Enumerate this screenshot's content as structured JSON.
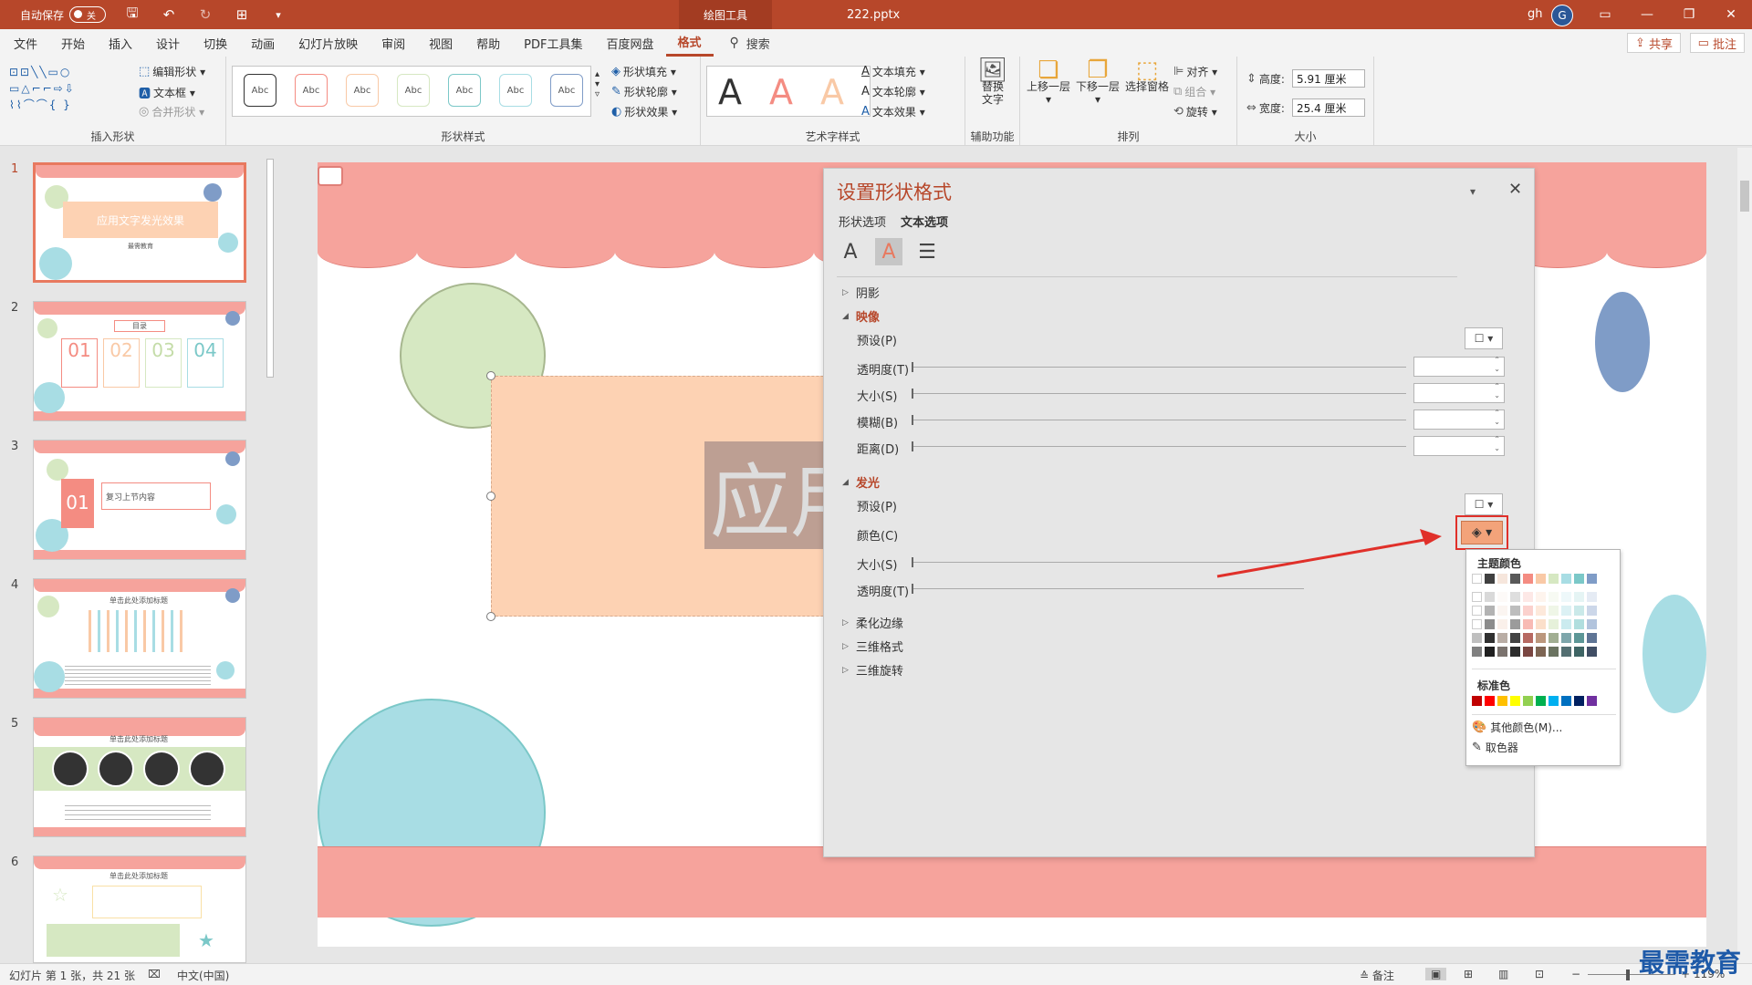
{
  "titlebar": {
    "autosave_label": "自动保存",
    "autosave_state": "关",
    "contextual_tab": "绘图工具",
    "doc_title": "222.pptx",
    "user_name": "gh",
    "user_initial": "G"
  },
  "menu": {
    "tabs": [
      "文件",
      "开始",
      "插入",
      "设计",
      "切换",
      "动画",
      "幻灯片放映",
      "审阅",
      "视图",
      "帮助",
      "PDF工具集",
      "百度网盘",
      "格式"
    ],
    "active_tab": "格式",
    "search_label": "搜索",
    "share_label": "共享",
    "comment_label": "批注"
  },
  "ribbon": {
    "insert_shapes": {
      "label": "插入形状",
      "edit_shape": "编辑形状",
      "text_box": "文本框",
      "merge_shapes": "合并形状"
    },
    "shape_styles": {
      "label": "形状样式",
      "swatch_text": "Abc",
      "fill": "形状填充",
      "outline": "形状轮廓",
      "effects": "形状效果"
    },
    "wordart": {
      "label": "艺术字样式",
      "letter": "A",
      "text_fill": "文本填充",
      "text_outline": "文本轮廓",
      "text_effects": "文本效果"
    },
    "accessibility": {
      "label": "辅助功能",
      "alt_text_line1": "替换",
      "alt_text_line2": "文字"
    },
    "arrange": {
      "label": "排列",
      "bring_forward": "上移一层",
      "send_backward": "下移一层",
      "selection_pane": "选择窗格",
      "align": "对齐",
      "group": "组合",
      "rotate": "旋转"
    },
    "size": {
      "label": "大小",
      "height_label": "高度:",
      "height_value": "5.91 厘米",
      "width_label": "宽度:",
      "width_value": "25.4 厘米"
    }
  },
  "thumbnails": [
    {
      "num": "1",
      "text": "应用文字发光效果",
      "sub": "最需教育"
    },
    {
      "num": "2",
      "text": "目录",
      "items": [
        "01",
        "02",
        "03",
        "04"
      ]
    },
    {
      "num": "3",
      "text": "复习上节内容",
      "badge": "01"
    },
    {
      "num": "4",
      "text": "单击此处添加标题"
    },
    {
      "num": "5",
      "text": "单击此处添加标题"
    },
    {
      "num": "6",
      "text": "单击此处添加标题"
    }
  ],
  "slide": {
    "title_fragment": "应用"
  },
  "format_pane": {
    "title": "设置形状格式",
    "tabs": [
      "形状选项",
      "文本选项"
    ],
    "active_tab": "文本选项",
    "sections": {
      "shadow": "阴影",
      "reflection": "映像",
      "glow": "发光",
      "soft_edges": "柔化边缘",
      "format_3d": "三维格式",
      "rotation_3d": "三维旋转"
    },
    "reflection_rows": [
      "预设(P)",
      "透明度(T)",
      "大小(S)",
      "模糊(B)",
      "距离(D)"
    ],
    "glow_rows": [
      "预设(P)",
      "颜色(C)",
      "大小(S)",
      "透明度(T)"
    ]
  },
  "color_picker": {
    "theme_colors_label": "主题颜色",
    "standard_colors_label": "标准色",
    "more_colors": "其他颜色(M)...",
    "eyedropper": "取色器",
    "theme_top_row": [
      "#ffffff",
      "#404040",
      "#f6e6dc",
      "#595959",
      "#f48c82",
      "#f9c9a6",
      "#d6e8c2",
      "#a8dde4",
      "#7bc8c8",
      "#7f9cc7"
    ],
    "standard_colors": [
      "#c00000",
      "#ff0000",
      "#ffc000",
      "#ffff00",
      "#92d050",
      "#00b050",
      "#00b0f0",
      "#0070c0",
      "#002060",
      "#7030a0"
    ]
  },
  "statusbar": {
    "slide_info": "幻灯片 第 1 张，共 21 张",
    "language": "中文(中国)",
    "notes": "备注",
    "zoom": "119%"
  },
  "watermark": "最需教育",
  "colors": {
    "accent": "#b7472a",
    "slide_pink": "#f6a39c",
    "glow_color_button": "#f3a37a",
    "highlight_box": "#e0302a"
  }
}
